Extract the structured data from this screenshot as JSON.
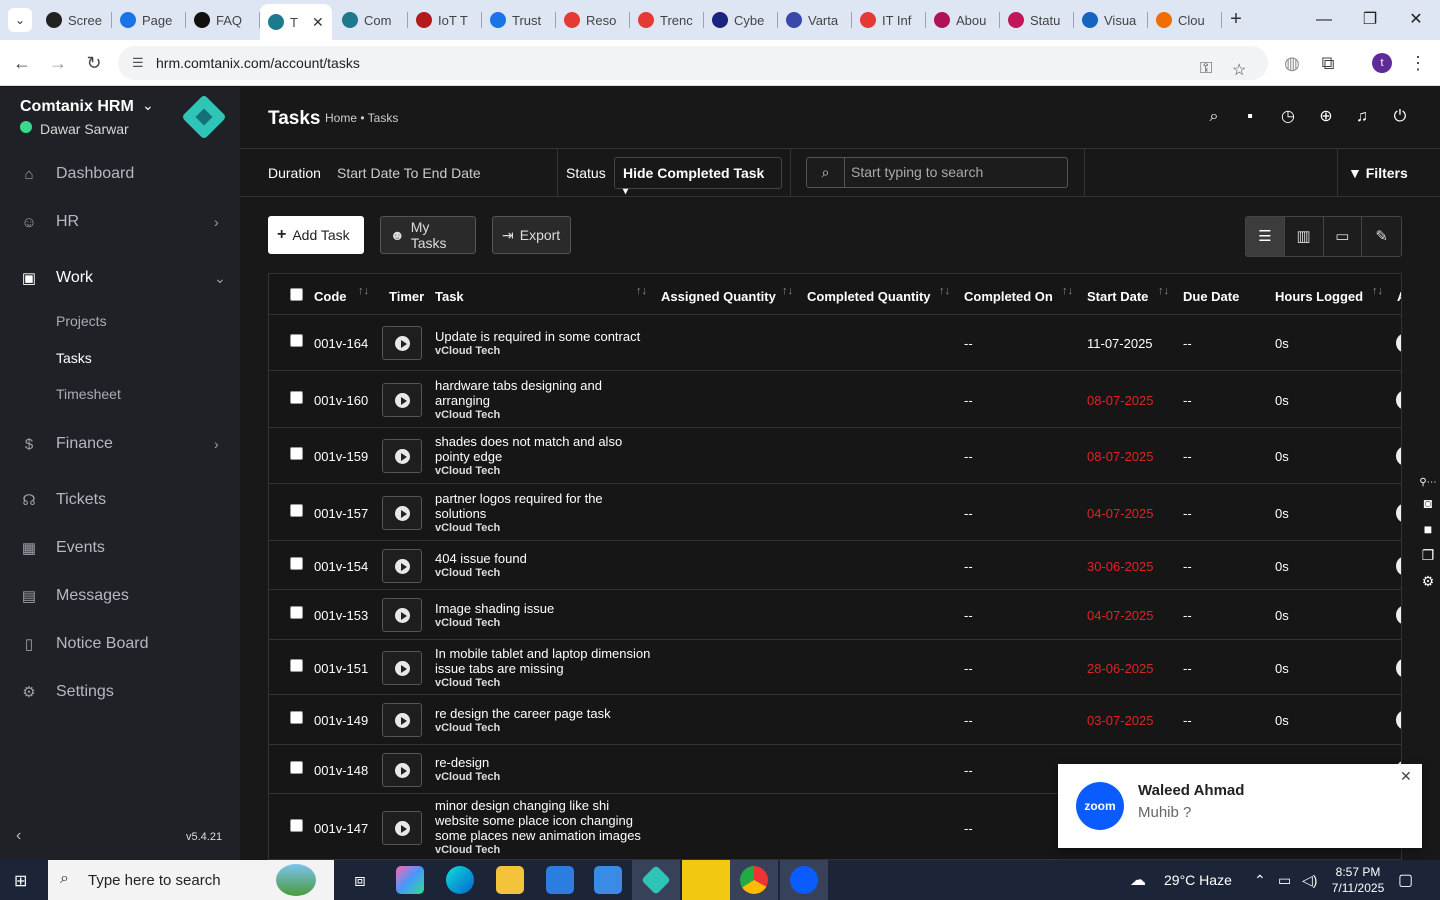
{
  "browser": {
    "tabs": [
      {
        "label": "Scree",
        "color": "#222222"
      },
      {
        "label": "Page",
        "color": "#1a73e8"
      },
      {
        "label": "FAQ",
        "color": "#111111"
      },
      {
        "label": "T",
        "color": "#1d7a8c",
        "active": true
      },
      {
        "label": "Com",
        "color": "#1d7a8c"
      },
      {
        "label": "IoT T",
        "color": "#b31b1b"
      },
      {
        "label": "Trust",
        "color": "#1a73e8"
      },
      {
        "label": "Reso",
        "color": "#e53935"
      },
      {
        "label": "Trenc",
        "color": "#e53935"
      },
      {
        "label": "Cybe",
        "color": "#1a237e"
      },
      {
        "label": "Varta",
        "color": "#3949ab"
      },
      {
        "label": "IT Inf",
        "color": "#e53935"
      },
      {
        "label": "Abou",
        "color": "#ad1457"
      },
      {
        "label": "Statu",
        "color": "#c2185b"
      },
      {
        "label": "Visua",
        "color": "#1565c0"
      },
      {
        "label": "Clou",
        "color": "#ef6c00"
      }
    ],
    "tab_close": "✕",
    "new_tab": "+",
    "url": "hrm.comtanix.com/account/tasks",
    "profile_initial": "t"
  },
  "sidebar": {
    "brand": "Comtanix HRM",
    "user": "Dawar Sarwar",
    "items": [
      {
        "label": "Dashboard",
        "icon": "home-icon",
        "glyph": "⌂"
      },
      {
        "label": "HR",
        "icon": "users-icon",
        "glyph": "☺"
      },
      {
        "label": "Work",
        "icon": "briefcase-icon",
        "glyph": "▣"
      },
      {
        "label": "Finance",
        "icon": "dollar-icon",
        "glyph": "$"
      },
      {
        "label": "Tickets",
        "icon": "headset-icon",
        "glyph": "☊"
      },
      {
        "label": "Events",
        "icon": "calendar-icon",
        "glyph": "▦"
      },
      {
        "label": "Messages",
        "icon": "message-icon",
        "glyph": "▤"
      },
      {
        "label": "Notice Board",
        "icon": "clipboard-icon",
        "glyph": "▯"
      },
      {
        "label": "Settings",
        "icon": "gear-icon",
        "glyph": "⚙"
      }
    ],
    "work_sub": [
      "Projects",
      "Tasks",
      "Timesheet"
    ],
    "version": "v5.4.21"
  },
  "header": {
    "title": "Tasks",
    "breadcrumb": "Home • Tasks"
  },
  "filters": {
    "duration_label": "Duration",
    "duration_value": "Start Date To End Date",
    "status_label": "Status",
    "status_value": "Hide Completed Task",
    "search_placeholder": "Start typing to search",
    "filters_label": "Filters"
  },
  "actions": {
    "add_task": "Add Task",
    "my_tasks": "My Tasks",
    "export": "Export"
  },
  "table": {
    "columns": [
      "Code",
      "Timer",
      "Task",
      "Assigned Quantity",
      "Completed Quantity",
      "Completed On",
      "Start Date",
      "Due Date",
      "Hours Logged",
      "A"
    ],
    "rows": [
      {
        "code": "001v-164",
        "title": "Update is required in some contract",
        "project": "vCloud Tech",
        "completed_on": "--",
        "start_date": "11-07-2025",
        "overdue": false,
        "due_date": "--",
        "hours": "0s"
      },
      {
        "code": "001v-160",
        "title": "hardware tabs designing and arranging",
        "project": "vCloud Tech",
        "completed_on": "--",
        "start_date": "08-07-2025",
        "overdue": true,
        "due_date": "--",
        "hours": "0s"
      },
      {
        "code": "001v-159",
        "title": "shades does not match and also pointy edge",
        "project": "vCloud Tech",
        "completed_on": "--",
        "start_date": "08-07-2025",
        "overdue": true,
        "due_date": "--",
        "hours": "0s"
      },
      {
        "code": "001v-157",
        "title": "partner logos required for the solutions",
        "project": "vCloud Tech",
        "completed_on": "--",
        "start_date": "04-07-2025",
        "overdue": true,
        "due_date": "--",
        "hours": "0s"
      },
      {
        "code": "001v-154",
        "title": "404 issue found",
        "project": "vCloud Tech",
        "completed_on": "--",
        "start_date": "30-06-2025",
        "overdue": true,
        "due_date": "--",
        "hours": "0s"
      },
      {
        "code": "001v-153",
        "title": "Image shading issue",
        "project": "vCloud Tech",
        "completed_on": "--",
        "start_date": "04-07-2025",
        "overdue": true,
        "due_date": "--",
        "hours": "0s"
      },
      {
        "code": "001v-151",
        "title": "In mobile tablet and laptop dimension issue tabs are missing",
        "project": "vCloud Tech",
        "completed_on": "--",
        "start_date": "28-06-2025",
        "overdue": true,
        "due_date": "--",
        "hours": "0s"
      },
      {
        "code": "001v-149",
        "title": "re design the career page task",
        "project": "vCloud Tech",
        "completed_on": "--",
        "start_date": "03-07-2025",
        "overdue": true,
        "due_date": "--",
        "hours": "0s"
      },
      {
        "code": "001v-148",
        "title": "re-design",
        "project": "vCloud Tech",
        "completed_on": "--",
        "start_date": "",
        "overdue": true,
        "due_date": "",
        "hours": ""
      },
      {
        "code": "001v-147",
        "title": "minor design changing like shi website some place icon changing some places new animation images",
        "project": "vCloud Tech",
        "completed_on": "--",
        "start_date": "",
        "overdue": false,
        "due_date": "",
        "hours": ""
      }
    ]
  },
  "notification": {
    "app": "zoom",
    "sender": "Waleed Ahmad",
    "message": "Muhib ?"
  },
  "taskbar": {
    "search_placeholder": "Type here to search",
    "weather": "29°C  Haze",
    "time": "8:57 PM",
    "date": "7/11/2025"
  }
}
